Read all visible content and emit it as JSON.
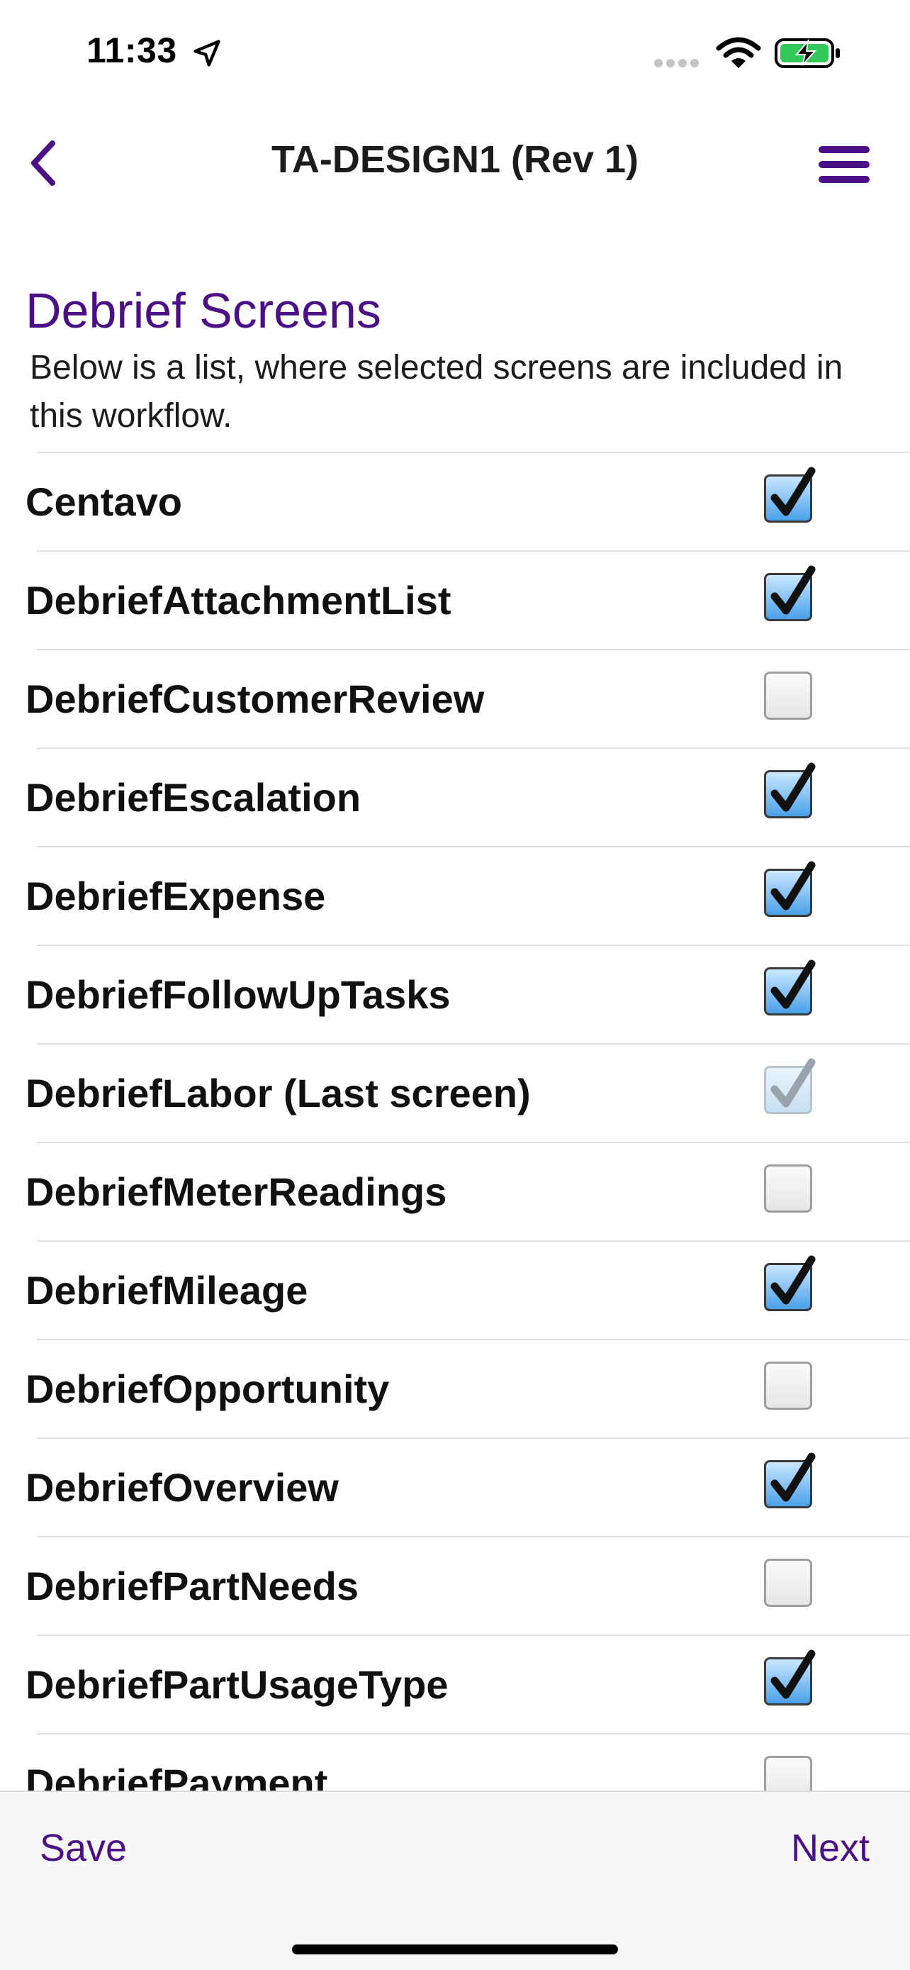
{
  "status_bar": {
    "time": "11:33",
    "battery_color": "#34c759"
  },
  "nav": {
    "title": "TA-DESIGN1 (Rev 1)",
    "back_icon": "chevron-left-icon",
    "menu_icon": "hamburger-menu-icon",
    "accent_color": "#4b0f86"
  },
  "section": {
    "title": "Debrief Screens",
    "description": "Below is a list, where selected screens are included in this workflow."
  },
  "items": [
    {
      "label": "Centavo",
      "state": "checked"
    },
    {
      "label": "DebriefAttachmentList",
      "state": "checked"
    },
    {
      "label": "DebriefCustomerReview",
      "state": "unchecked"
    },
    {
      "label": "DebriefEscalation",
      "state": "checked"
    },
    {
      "label": "DebriefExpense",
      "state": "checked"
    },
    {
      "label": "DebriefFollowUpTasks",
      "state": "checked"
    },
    {
      "label": "DebriefLabor (Last screen)",
      "state": "disabled"
    },
    {
      "label": "DebriefMeterReadings",
      "state": "unchecked"
    },
    {
      "label": "DebriefMileage",
      "state": "checked"
    },
    {
      "label": "DebriefOpportunity",
      "state": "unchecked"
    },
    {
      "label": "DebriefOverview",
      "state": "checked"
    },
    {
      "label": "DebriefPartNeeds",
      "state": "unchecked"
    },
    {
      "label": "DebriefPartUsageType",
      "state": "checked"
    },
    {
      "label": "DebriefPayment",
      "state": "unchecked"
    }
  ],
  "footer": {
    "save_label": "Save",
    "next_label": "Next"
  }
}
